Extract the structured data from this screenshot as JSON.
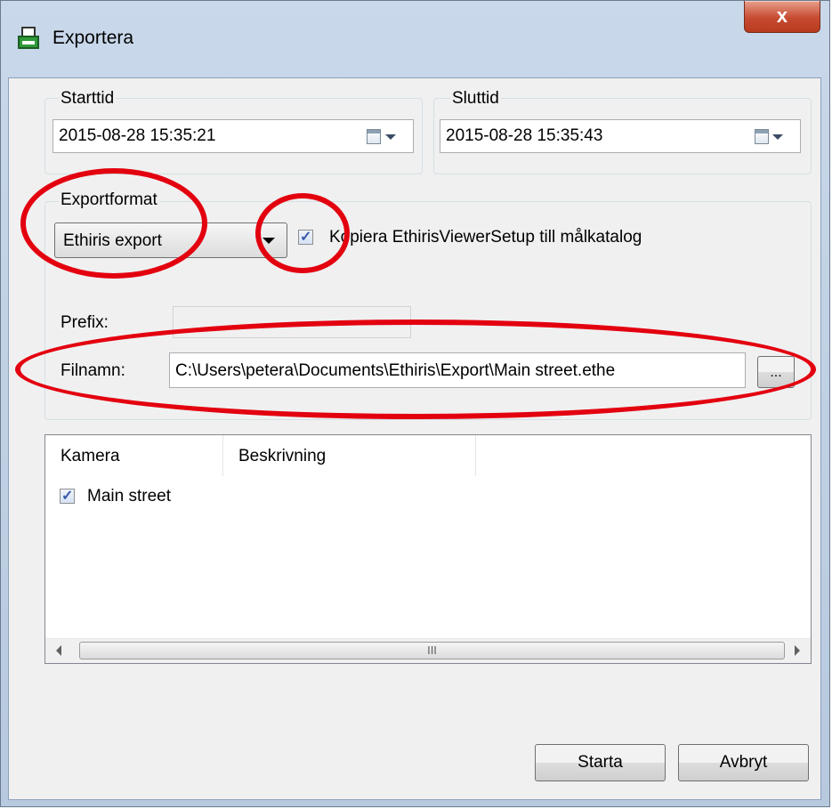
{
  "window": {
    "title": "Exportera",
    "close_label": "x"
  },
  "start": {
    "legend": "Starttid",
    "value": "2015-08-28 15:35:21"
  },
  "end": {
    "legend": "Sluttid",
    "value": "2015-08-28 15:35:43"
  },
  "export": {
    "legend": "Exportformat",
    "format_value": "Ethiris export",
    "copy_checkbox_checked": true,
    "copy_checkbox_label": "Kopiera EthirisViewerSetup till målkatalog",
    "prefix_label": "Prefix:",
    "prefix_value": "",
    "filename_label": "Filnamn:",
    "filename_value": "C:\\Users\\petera\\Documents\\Ethiris\\Export\\Main street.ethe",
    "browse_label": "..."
  },
  "camera_list": {
    "columns": [
      "Kamera",
      "Beskrivning"
    ],
    "rows": [
      {
        "checked": true,
        "name": "Main street",
        "description": ""
      }
    ],
    "scroll_grip": "III"
  },
  "buttons": {
    "start": "Starta",
    "cancel": "Avbryt"
  },
  "icons": [
    "export-app-icon",
    "calendar-icon",
    "chevron-down-icon",
    "check-icon",
    "scroll-left-icon",
    "scroll-right-icon"
  ],
  "colors": {
    "annotation": "#e3000f",
    "close_button": "#c74b31"
  }
}
